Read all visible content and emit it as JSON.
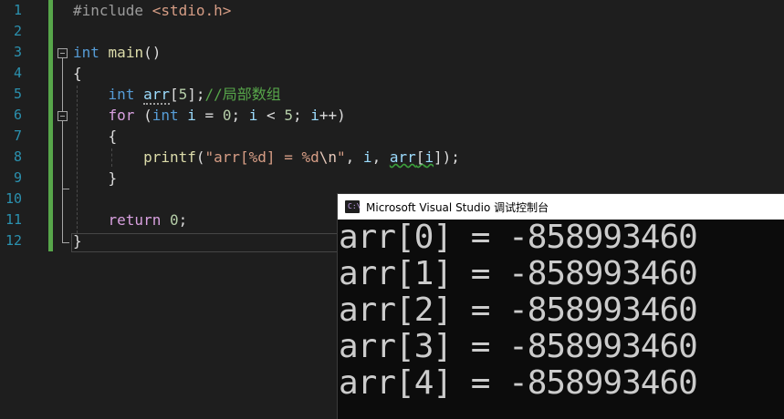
{
  "editor": {
    "line_numbers": [
      "1",
      "2",
      "3",
      "4",
      "5",
      "6",
      "7",
      "8",
      "9",
      "10",
      "11",
      "12"
    ],
    "line1": {
      "directive": "#include",
      "header": "<stdio.h>"
    },
    "line3": {
      "kw_int": "int",
      "fn_main": "main",
      "parens": "()"
    },
    "line4": {
      "brace": "{"
    },
    "line5": {
      "kw_int": "int",
      "var": "arr",
      "bracket": "[",
      "num": "5",
      "tail": "];",
      "comment": "//局部数组"
    },
    "line6": {
      "kw_for": "for",
      "paren": "(",
      "kw_int": "int",
      "var_i": "i",
      "eq": "=",
      "zero": "0",
      "semi1": ";",
      "var_i2": "i",
      "lt": "<",
      "five": "5",
      "semi2": ";",
      "var_i3": "i",
      "inc": "++)"
    },
    "line7": {
      "brace": "{"
    },
    "line8": {
      "fn": "printf",
      "paren": "(",
      "str1": "\"arr[%d] = %d",
      "esc": "\\n",
      "str2": "\"",
      "comma1": ",",
      "var_i": "i",
      "comma2": ",",
      "var_arr": "arr",
      "bracket_open": "[",
      "var_i2": "i",
      "bracket_close": "]",
      "tail": ");"
    },
    "line9": {
      "brace": "}"
    },
    "line11": {
      "kw_return": "return",
      "zero": "0",
      "semi": ";"
    },
    "line12": {
      "brace": "}"
    }
  },
  "console": {
    "icon": "console-app-icon",
    "icon_text": "C:\\",
    "title": "Microsoft Visual Studio 调试控制台",
    "output": [
      "arr[0] = -858993460",
      "arr[1] = -858993460",
      "arr[2] = -858993460",
      "arr[3] = -858993460",
      "arr[4] = -858993460"
    ]
  },
  "colors": {
    "background": "#1e1e1e",
    "keyword": "#569cd6",
    "function": "#dcdcaa",
    "comment": "#57a64a",
    "string": "#d69d85",
    "line_number": "#2b91af",
    "change_bar": "#57a64a",
    "console_bg": "#0c0c0c"
  }
}
